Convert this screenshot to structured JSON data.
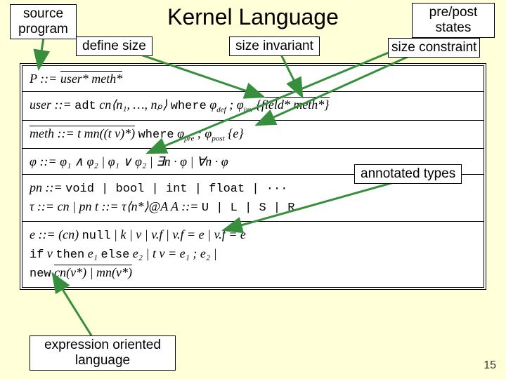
{
  "title": "Kernel Language",
  "annotations": {
    "source_program": "source\nprogram",
    "define_size": "define size",
    "size_invariant": "size invariant",
    "prepost_states": "pre/post\nstates",
    "size_constraint": "size constraint",
    "annotated_types": "annotated types",
    "expression_oriented": "expression oriented\nlanguage"
  },
  "grammar": {
    "row1": {
      "lhs": "P ::= ",
      "rhs": "user* meth*"
    },
    "row2": {
      "lhs": "user ::= ",
      "kw_adt": "adt",
      "mid": " cn⟨n₁, …, nₚ⟩ ",
      "kw_where": "where",
      "phidef": " φ",
      "sub_def": "def",
      "sep": " ; ",
      "phiinv": "φ",
      "sub_inv": "inv",
      "tail": " {field* meth*}"
    },
    "row3": {
      "lhs": "meth ::= t mn((t v)*) ",
      "kw_where": "where",
      "phipre": " φ",
      "sub_pre": "pre",
      "sep": " ; ",
      "phipost": "φ",
      "sub_post": "post",
      "tail": " {e}"
    },
    "row4": {
      "lhs": "φ ::=  φ₁ ∧ φ₂  |  φ₁ ∨ φ₂  |  ∃n · φ  |  ∀n · φ"
    },
    "row5": {
      "pn_lhs": "pn ::= ",
      "pn_rhs": "void  |  bool  |  int  |  float  |  ···",
      "tau_lhs": "τ  ::= cn  |  pn      t ::= τ⟨n*⟩@A      A ::= ",
      "a_opts": "U  |  L  |  S  |  R"
    },
    "row6": {
      "line1_a": "e ::= (cn) ",
      "null": "null",
      "line1_b": "  |  k  |  v  |  v.f  |  v.f = e  |  v.f = e",
      "line2_a": "       ",
      "if": "if",
      "line2_b": " v ",
      "then": "then",
      "line2_c": " e₁ ",
      "else": "else",
      "line2_d": " e₂   |  t v = e₁ ; e₂  |",
      "line3_a": "       ",
      "new": "new",
      "line3_b": " cn(v*)  |  mn(v*)"
    }
  },
  "slidenum": "15"
}
